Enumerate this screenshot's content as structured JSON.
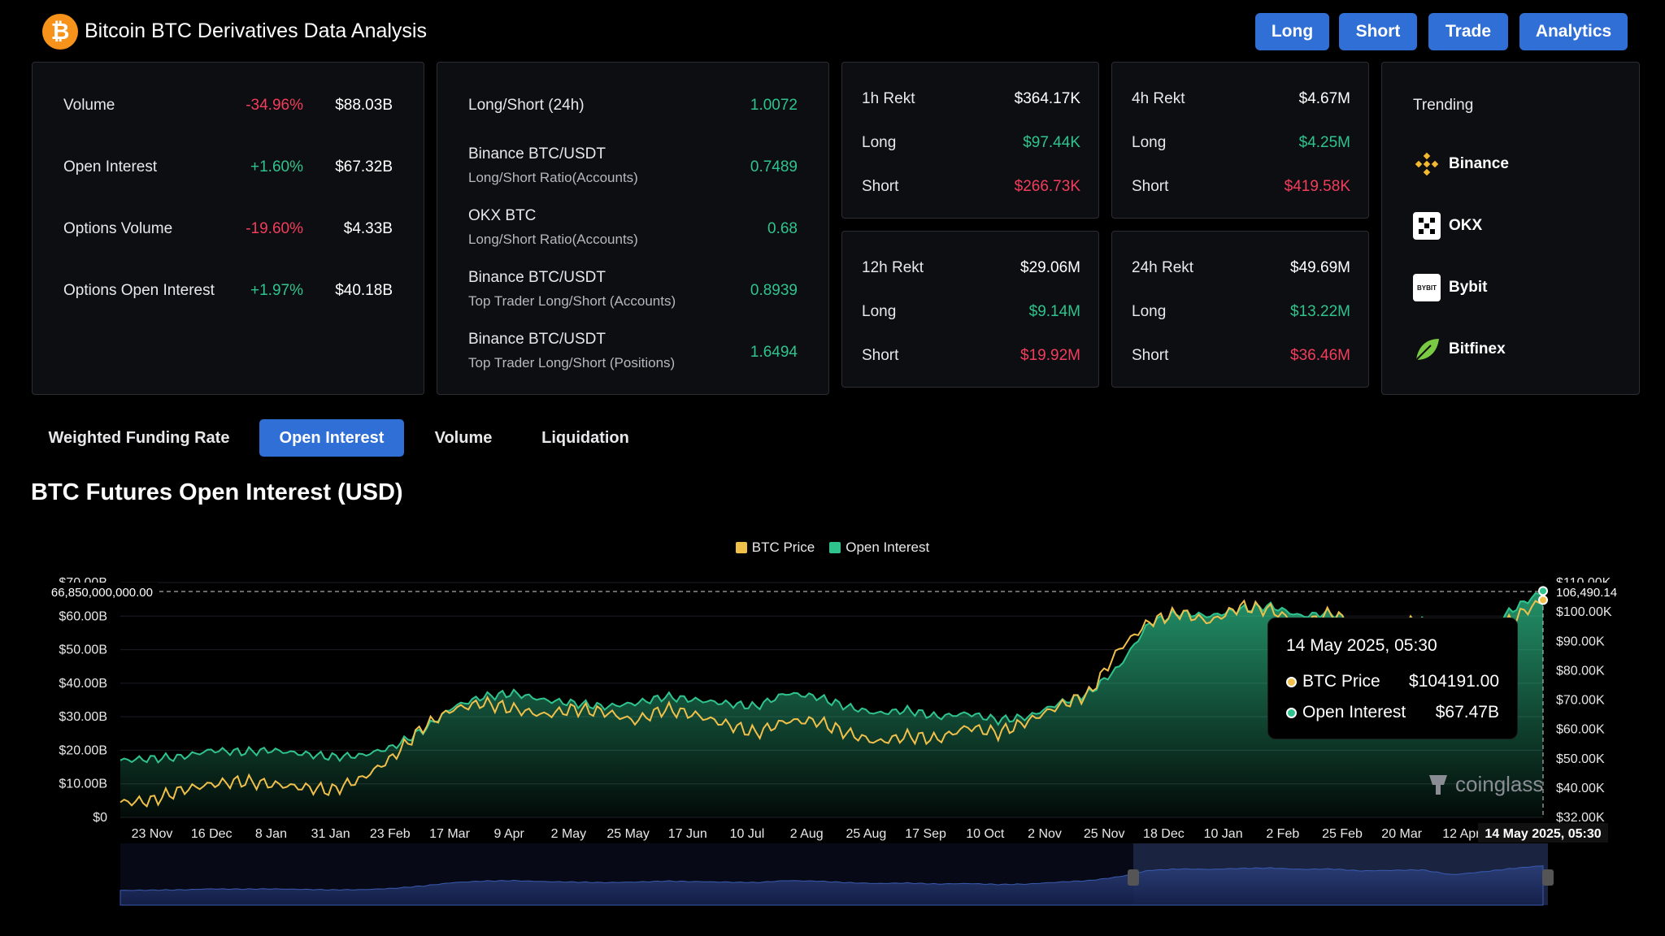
{
  "header": {
    "title": "Bitcoin BTC Derivatives Data Analysis",
    "logo_glyph": "₿",
    "buttons": [
      {
        "label": "Long"
      },
      {
        "label": "Short"
      },
      {
        "label": "Trade"
      },
      {
        "label": "Analytics"
      }
    ]
  },
  "overview": [
    {
      "label": "Volume",
      "change": "-34.96%",
      "value": "$88.03B"
    },
    {
      "label": "Open Interest",
      "change": "+1.60%",
      "value": "$67.32B"
    },
    {
      "label": "Options Volume",
      "change": "-19.60%",
      "value": "$4.33B"
    },
    {
      "label": "Options Open Interest",
      "change": "+1.97%",
      "value": "$40.18B"
    }
  ],
  "ratios": [
    {
      "label": "Long/Short (24h)",
      "sub": "",
      "value": "1.0072"
    },
    {
      "label": "Binance BTC/USDT",
      "sub": "Long/Short Ratio(Accounts)",
      "value": "0.7489"
    },
    {
      "label": "OKX BTC",
      "sub": "Long/Short Ratio(Accounts)",
      "value": "0.68"
    },
    {
      "label": "Binance BTC/USDT",
      "sub": "Top Trader Long/Short (Accounts)",
      "value": "0.8939"
    },
    {
      "label": "Binance BTC/USDT",
      "sub": "Top Trader Long/Short (Positions)",
      "value": "1.6494"
    }
  ],
  "rekt": [
    {
      "title": "1h Rekt",
      "total": "$364.17K",
      "long_label": "Long",
      "long": "$97.44K",
      "short_label": "Short",
      "short": "$266.73K"
    },
    {
      "title": "4h Rekt",
      "total": "$4.67M",
      "long_label": "Long",
      "long": "$4.25M",
      "short_label": "Short",
      "short": "$419.58K"
    },
    {
      "title": "12h Rekt",
      "total": "$29.06M",
      "long_label": "Long",
      "long": "$9.14M",
      "short_label": "Short",
      "short": "$19.92M"
    },
    {
      "title": "24h Rekt",
      "total": "$49.69M",
      "long_label": "Long",
      "long": "$13.22M",
      "short_label": "Short",
      "short": "$36.46M"
    }
  ],
  "trending": {
    "title": "Trending",
    "items": [
      {
        "name": "Binance",
        "icon": "binance-icon"
      },
      {
        "name": "OKX",
        "icon": "okx-icon"
      },
      {
        "name": "Bybit",
        "icon": "bybit-icon",
        "icon_text": "BYBIT"
      },
      {
        "name": "Bitfinex",
        "icon": "bitfinex-icon"
      }
    ]
  },
  "tabs": [
    {
      "label": "Weighted Funding Rate",
      "active": false
    },
    {
      "label": "Open Interest",
      "active": true
    },
    {
      "label": "Volume",
      "active": false
    },
    {
      "label": "Liquidation",
      "active": false
    }
  ],
  "chart_title": "BTC Futures Open Interest (USD)",
  "tooltip": {
    "date": "14 May 2025, 05:30",
    "btc_label": "BTC Price",
    "btc_value": "$104191.00",
    "oi_label": "Open Interest",
    "oi_value": "$67.47B"
  },
  "watermark": "coinglass",
  "colors": {
    "btc": "#f0c04a",
    "oi": "#2fc48d",
    "accent": "#2f6fd6",
    "red": "#f23d5c",
    "green": "#2fc48d"
  },
  "chart_data": {
    "type": "area",
    "legend": [
      "BTC Price",
      "Open Interest"
    ],
    "legend_position": "top-center",
    "x_ticks": [
      "23 Nov",
      "16 Dec",
      "8 Jan",
      "31 Jan",
      "23 Feb",
      "17 Mar",
      "9 Apr",
      "2 May",
      "25 May",
      "17 Jun",
      "10 Jul",
      "2 Aug",
      "25 Aug",
      "17 Sep",
      "10 Oct",
      "2 Nov",
      "25 Nov",
      "18 Dec",
      "10 Jan",
      "2 Feb",
      "25 Feb",
      "20 Mar",
      "12 Apr"
    ],
    "x_current": "14 May 2025, 05:30",
    "y_left_ticks": [
      "$0",
      "$10.00B",
      "$20.00B",
      "$30.00B",
      "$40.00B",
      "$50.00B",
      "$60.00B",
      "$70.00B"
    ],
    "y_left_range": [
      0,
      70
    ],
    "y_right_ticks": [
      "$32.00K",
      "$40.00K",
      "$50.00K",
      "$60.00K",
      "$70.00K",
      "$80.00K",
      "$90.00K",
      "$100.00K",
      "$110.00K"
    ],
    "y_right_range": [
      32,
      110
    ],
    "crosshair_left_label": "66,850,000,000.00",
    "crosshair_right_label": "106,490.14",
    "series": [
      {
        "name": "Open Interest",
        "unit": "B USD",
        "values": [
          17,
          17.5,
          18,
          20,
          19.5,
          20,
          19,
          18,
          18.5,
          21,
          26,
          33,
          36,
          37,
          35,
          34,
          33,
          34,
          36,
          35,
          34,
          33,
          37,
          36,
          33,
          31,
          32,
          30,
          31,
          29,
          30,
          34,
          37,
          45,
          58,
          61,
          60,
          62,
          63,
          60,
          61,
          57,
          58,
          59,
          49,
          55,
          62,
          67.5
        ]
      },
      {
        "name": "BTC Price",
        "unit": "K USD",
        "values": [
          37,
          37.5,
          41,
          43,
          44,
          43,
          42,
          41,
          45,
          52,
          62,
          68,
          70,
          68,
          66,
          68,
          67,
          64,
          68,
          66,
          63,
          60,
          64,
          64,
          60,
          57,
          59,
          58,
          62,
          60,
          64,
          69,
          73,
          88,
          97,
          100,
          97,
          102,
          101,
          96,
          100,
          94,
          96,
          97,
          83,
          90,
          98,
          104.2
        ]
      }
    ]
  }
}
